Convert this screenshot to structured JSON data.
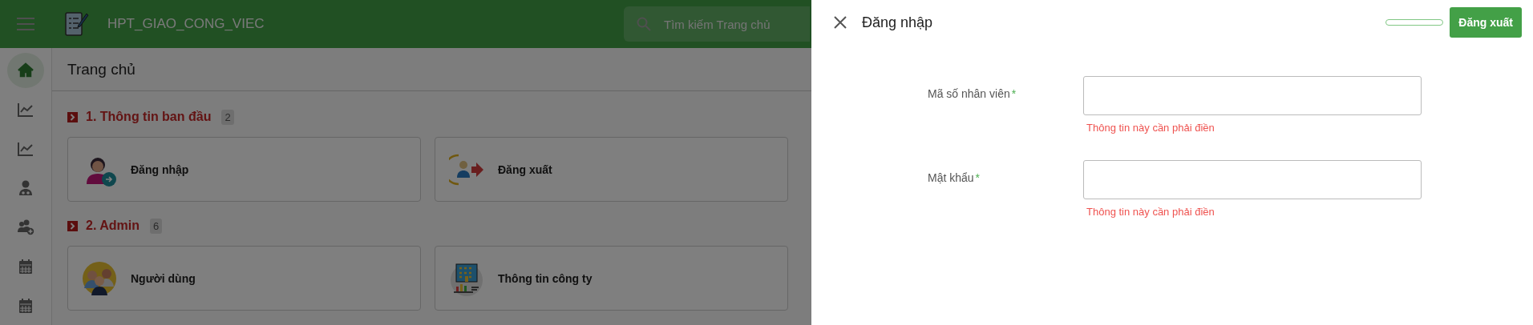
{
  "app_bar": {
    "title": "HPT_GIAO_CONG_VIEC",
    "search": {
      "placeholder": "Tìm kiếm Trang chủ"
    }
  },
  "sidebar": {
    "items": [
      {
        "kind": "home",
        "selected": true
      },
      {
        "kind": "chart",
        "selected": false
      },
      {
        "kind": "chart",
        "selected": false
      },
      {
        "kind": "doctor",
        "selected": false
      },
      {
        "kind": "user-add",
        "selected": false
      },
      {
        "kind": "calendar",
        "selected": false
      },
      {
        "kind": "calendar",
        "selected": false
      }
    ]
  },
  "page_title": "Trang chủ",
  "sections": [
    {
      "title": "1. Thông tin ban đầu",
      "count": "2",
      "cards": [
        {
          "kind": "login",
          "label": "Đăng nhập"
        },
        {
          "kind": "logout",
          "label": "Đăng xuất"
        }
      ]
    },
    {
      "title": "2. Admin",
      "count": "6",
      "cards": [
        {
          "kind": "users",
          "label": "Người dùng"
        },
        {
          "kind": "company",
          "label": "Thông tin công ty"
        }
      ]
    }
  ],
  "drawer": {
    "title": "Đăng nhập",
    "action_button": "Đăng xuất",
    "fields": [
      {
        "label": "Mã số nhân viên",
        "required_mark": "*",
        "error": "Thông tin này cần phải điền"
      },
      {
        "label": "Mật khẩu",
        "required_mark": "*",
        "error": "Thông tin này cần phải điền"
      }
    ]
  }
}
